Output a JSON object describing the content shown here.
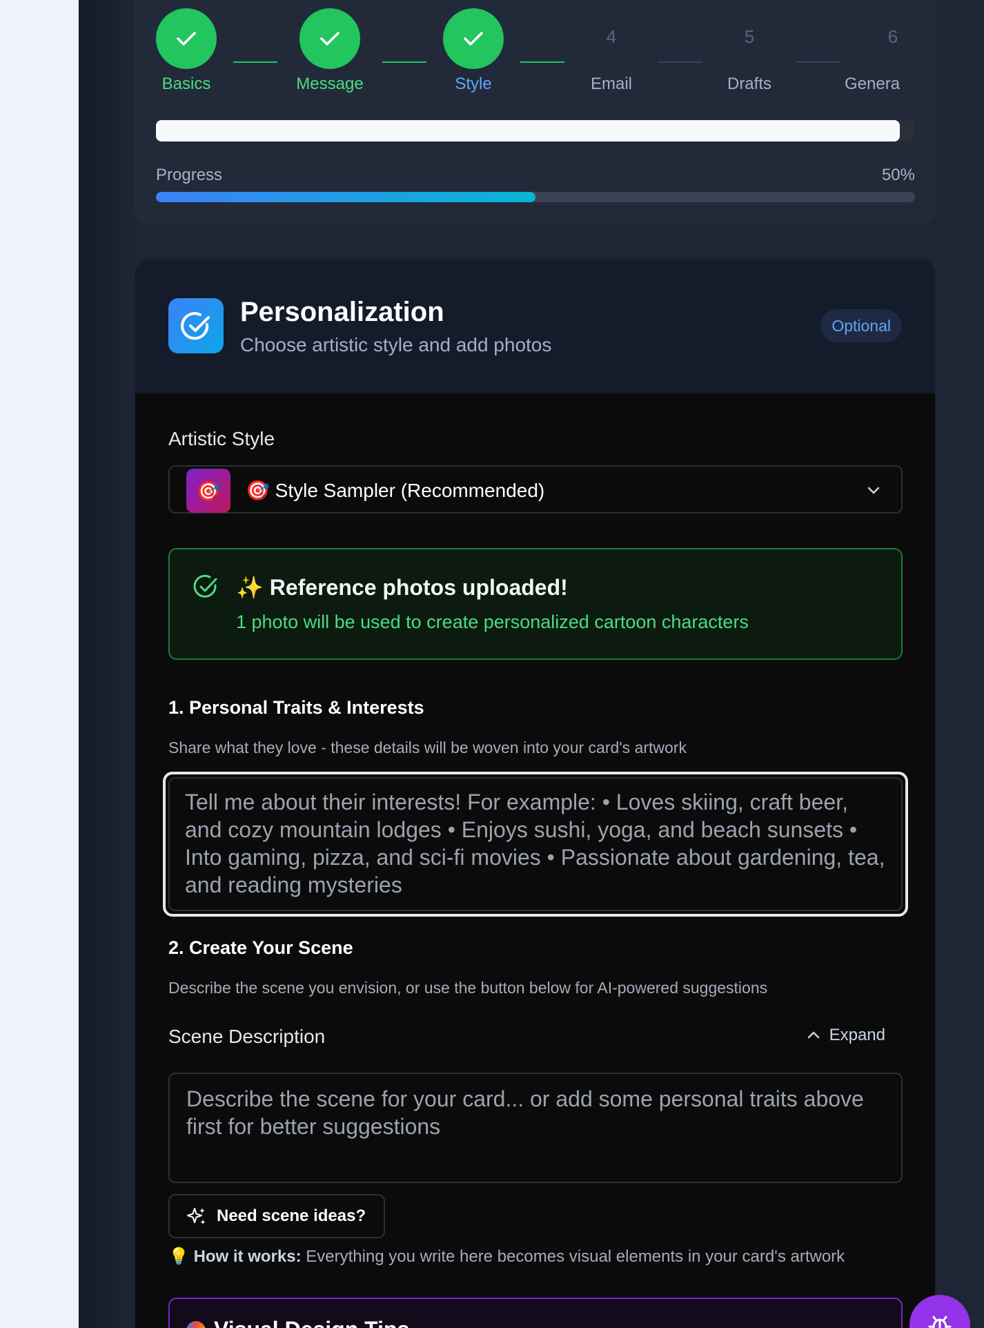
{
  "stepper": {
    "steps": [
      {
        "number": "1",
        "label": "Basics",
        "state": "done"
      },
      {
        "number": "2",
        "label": "Message",
        "state": "done"
      },
      {
        "number": "3",
        "label": "Style",
        "state": "current"
      },
      {
        "number": "4",
        "label": "Email",
        "state": "todo"
      },
      {
        "number": "5",
        "label": "Drafts",
        "state": "todo"
      },
      {
        "number": "6",
        "label": "Genera",
        "state": "todo"
      }
    ],
    "progress_label": "Progress",
    "progress_value": "50%",
    "progress_fraction": 0.5
  },
  "card": {
    "title": "Personalization",
    "subtitle": "Choose artistic style and add photos",
    "badge": "Optional",
    "artistic_style": {
      "label": "Artistic Style",
      "thumb_emoji": "🎯",
      "selected": "🎯 Style Sampler (Recommended)"
    },
    "upload_notice": {
      "title": "✨ Reference photos uploaded!",
      "message": "1 photo will be used to create personalized cartoon characters"
    },
    "traits": {
      "heading": "1. Personal Traits & Interests",
      "helper": "Share what they love - these details will be woven into your card's artwork",
      "placeholder": "Tell me about their interests! For example: • Loves skiing, craft beer, and cozy mountain lodges • Enjoys sushi, yoga, and beach sunsets • Into gaming, pizza, and sci-fi movies • Passionate about gardening, tea, and reading mysteries"
    },
    "scene": {
      "heading": "2. Create Your Scene",
      "helper": "Describe the scene you envision, or use the button below for AI-powered suggestions",
      "description_label": "Scene Description",
      "expand_label": "Expand",
      "placeholder": "Describe the scene for your card... or add some personal traits above first for better suggestions",
      "ideas_button": "Need scene ideas?",
      "how_prefix": "💡",
      "how_bold": "How it works:",
      "how_text": " Everything you write here becomes visual elements in your card's artwork"
    },
    "tips_title": "Visual Design Tips"
  },
  "colors": {
    "success": "#22c55e",
    "current_step": "#60a5fa",
    "accent_purple": "#9333ea"
  },
  "icons": {
    "step_done": "check-icon",
    "header": "check-circle-icon",
    "select": "chevron-down-icon",
    "expand": "chevron-up-icon",
    "ideas": "sparkles-icon",
    "fab": "bug-icon"
  }
}
